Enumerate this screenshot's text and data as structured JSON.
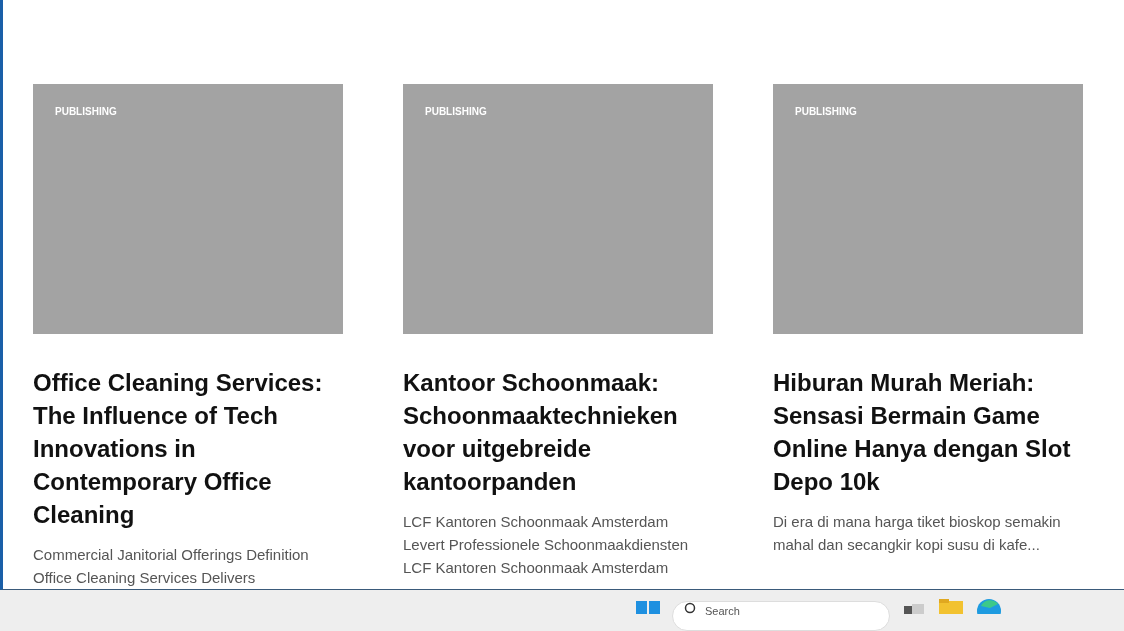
{
  "cards": [
    {
      "category": "PUBLISHING",
      "title": "Office Cleaning Services: The Influence of Tech Innovations in Contemporary Office Cleaning",
      "excerpt": "Commercial Janitorial Offerings Definition Office Cleaning Services Delivers"
    },
    {
      "category": "PUBLISHING",
      "title": "Kantoor Schoonmaak: Schoonmaaktechnieken voor uitgebreide kantoorpanden",
      "excerpt": "LCF Kantoren Schoonmaak Amsterdam Levert Professionele Schoonmaakdiensten LCF Kantoren Schoonmaak Amsterdam"
    },
    {
      "category": "PUBLISHING",
      "title": "Hiburan Murah Meriah: Sensasi Bermain Game Online Hanya dengan Slot Depo 10k",
      "excerpt": "Di era di mana harga tiket bioskop semakin mahal dan secangkir kopi susu di kafe..."
    }
  ],
  "taskbar": {
    "search": {
      "placeholder": "Search"
    }
  }
}
